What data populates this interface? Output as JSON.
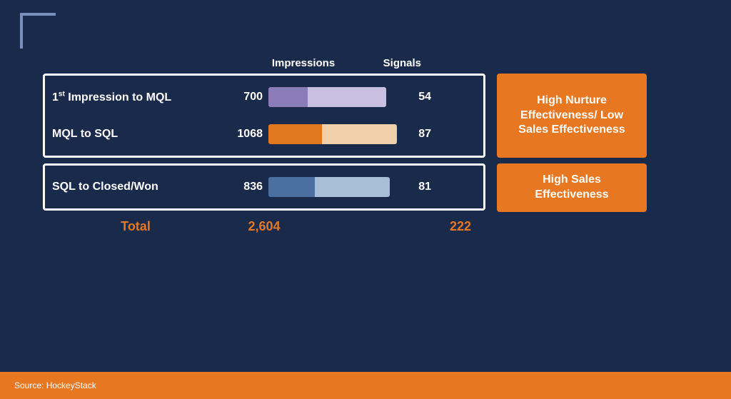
{
  "corner": {
    "decoration": "corner-bracket"
  },
  "headers": {
    "impressions": "Impressions",
    "signals": "Signals"
  },
  "rows": [
    {
      "label_pre": "1",
      "label_sup": "st",
      "label_post": " Impression to MQL",
      "impressions": "700",
      "signals": "54",
      "bar_type": "purple"
    },
    {
      "label": "MQL to SQL",
      "impressions": "1068",
      "signals": "87",
      "bar_type": "orange"
    },
    {
      "label": "SQL to Closed/Won",
      "impressions": "836",
      "signals": "81",
      "bar_type": "blue"
    }
  ],
  "labels": {
    "box1": "High Nurture Effectiveness/ Low Sales Effectiveness",
    "box2": "High Sales Effectiveness"
  },
  "totals": {
    "label": "Total",
    "impressions": "2,604",
    "signals": "222"
  },
  "footer": {
    "source": "Source: HockeyStack"
  }
}
